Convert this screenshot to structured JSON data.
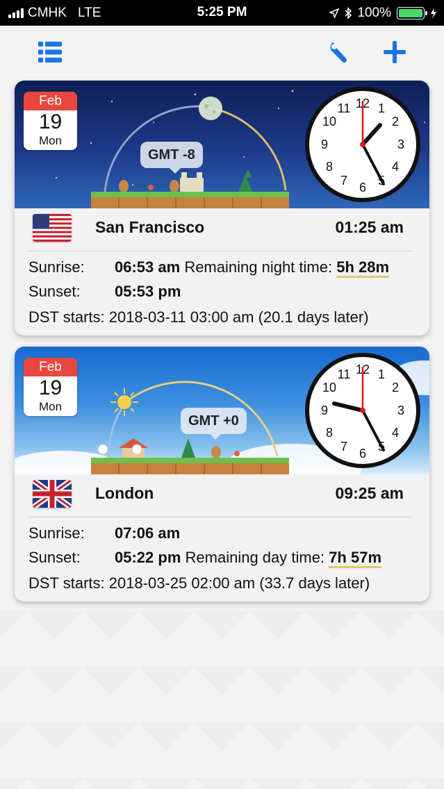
{
  "status_bar": {
    "carrier": "CMHK",
    "network": "LTE",
    "time": "5:25 PM",
    "battery": "100%"
  },
  "toolbar": {
    "list_icon": "list-icon",
    "settings_icon": "wrench-icon",
    "add_icon": "plus-icon",
    "accent_color": "#1a74e6"
  },
  "cities": [
    {
      "calendar": {
        "month": "Feb",
        "day": "19",
        "weekday": "Mon"
      },
      "gmt": "GMT -8",
      "scene": "night",
      "name": "San Francisco",
      "local_time": "01:25 am",
      "flag": "us-flag",
      "sunrise_label": "Sunrise:",
      "sunrise": "06:53 am",
      "sunset_label": "Sunset:",
      "sunset": "05:53 pm",
      "remaining_label": "Remaining night time:",
      "remaining": "5h 28m",
      "dst_text": "DST starts: 2018-03-11 03:00 am (20.1 days later)"
    },
    {
      "calendar": {
        "month": "Feb",
        "day": "19",
        "weekday": "Mon"
      },
      "gmt": "GMT +0",
      "scene": "day",
      "name": "London",
      "local_time": "09:25 am",
      "flag": "uk-flag",
      "sunrise_label": "Sunrise:",
      "sunrise": "07:06 am",
      "sunset_label": "Sunset:",
      "sunset": "05:22 pm",
      "remaining_label": "Remaining day time:",
      "remaining": "7h 57m",
      "dst_text": "DST starts: 2018-03-25 02:00 am (33.7 days later)"
    }
  ]
}
